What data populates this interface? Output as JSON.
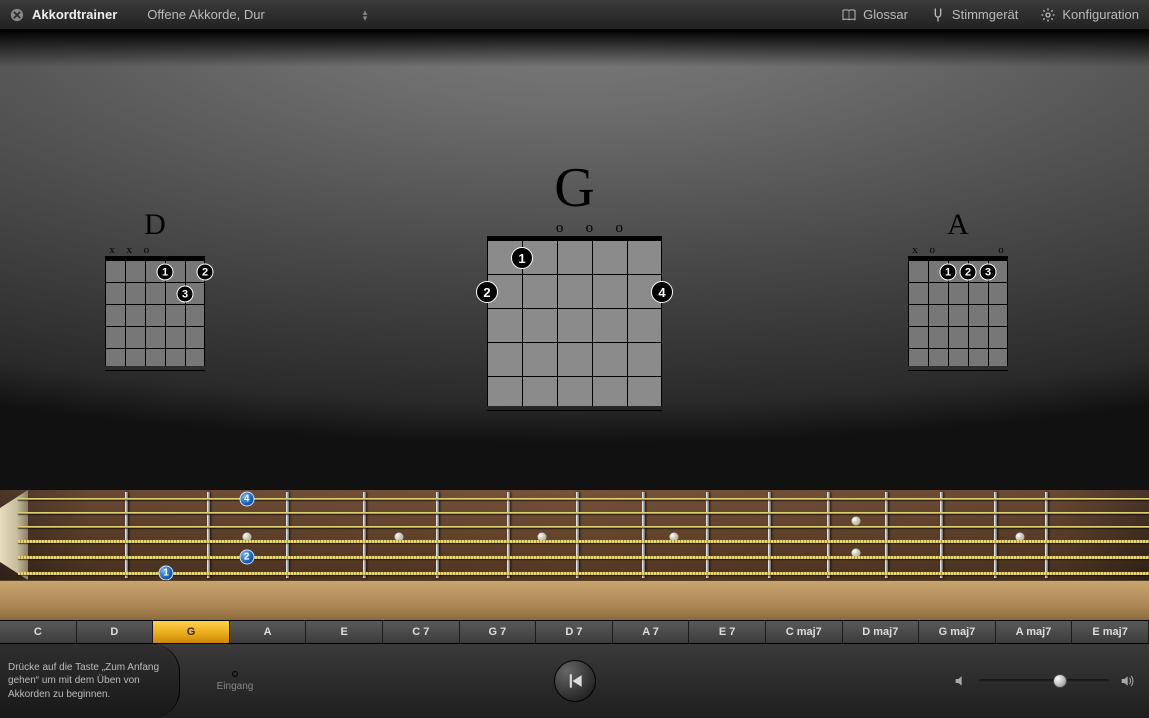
{
  "topbar": {
    "title": "Akkordtrainer",
    "lesson_select": "Offene Akkorde, Dur",
    "glossary": "Glossar",
    "tuner": "Stimmgerät",
    "settings": "Konfiguration"
  },
  "chords": {
    "left": {
      "name": "D",
      "markers": [
        "x",
        "x",
        "o",
        "",
        "",
        ""
      ],
      "dots": [
        {
          "s": 3,
          "f": 1,
          "n": "1"
        },
        {
          "s": 5,
          "f": 1,
          "n": "2"
        },
        {
          "s": 4,
          "f": 2,
          "n": "3"
        }
      ]
    },
    "center": {
      "name": "G",
      "markers": [
        "",
        "",
        "o",
        "o",
        "o",
        ""
      ],
      "dots": [
        {
          "s": 1,
          "f": 1,
          "n": "1"
        },
        {
          "s": 0,
          "f": 2,
          "n": "2"
        },
        {
          "s": 5,
          "f": 2,
          "n": "4"
        }
      ]
    },
    "right": {
      "name": "A",
      "markers": [
        "x",
        "o",
        "",
        "",
        "",
        "o"
      ],
      "dots": [
        {
          "s": 2,
          "f": 1,
          "n": "1"
        },
        {
          "s": 3,
          "f": 1,
          "n": "2"
        },
        {
          "s": 4,
          "f": 1,
          "n": "3"
        }
      ]
    }
  },
  "fretboard": {
    "fingers": [
      {
        "fret": 2,
        "string": 5,
        "n": "1"
      },
      {
        "fret": 3,
        "string": 0,
        "n": "4"
      },
      {
        "fret": 3,
        "string": 4,
        "n": "2"
      }
    ]
  },
  "chord_buttons": [
    "C",
    "D",
    "G",
    "A",
    "E",
    "C 7",
    "G 7",
    "D 7",
    "A 7",
    "E 7",
    "C maj7",
    "D maj7",
    "G maj7",
    "A maj7",
    "E maj7"
  ],
  "active_chord_index": 2,
  "footer": {
    "hint": "Drücke auf die Taste „Zum Anfang gehen“ um mit dem Üben von Akkorden zu beginnen.",
    "input_label": "Eingang",
    "volume_pct": 62
  }
}
